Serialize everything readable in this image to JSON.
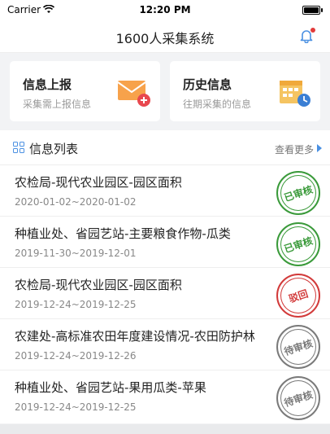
{
  "status_bar": {
    "carrier": "Carrier",
    "time": "12:20 PM"
  },
  "nav": {
    "title": "1600人采集系统",
    "bell_icon": "bell-icon"
  },
  "cards": [
    {
      "title": "信息上报",
      "subtitle": "采集需上报信息",
      "icon": "envelope-add-icon"
    },
    {
      "title": "历史信息",
      "subtitle": "往期采集的信息",
      "icon": "calendar-clock-icon"
    }
  ],
  "list": {
    "title": "信息列表",
    "more": "查看更多",
    "items": [
      {
        "title": "农检局-现代农业园区-园区面积",
        "date": "2020-01-02~2020-01-02",
        "status": "已审核",
        "status_color": "#3a9a3a"
      },
      {
        "title": "种植业处、省园艺站-主要粮食作物-瓜类",
        "date": "2019-11-30~2019-12-01",
        "status": "已审核",
        "status_color": "#3a9a3a"
      },
      {
        "title": "农检局-现代农业园区-园区面积",
        "date": "2019-12-24~2019-12-25",
        "status": "驳回",
        "status_color": "#d23a3a"
      },
      {
        "title": "农建处-高标准农田年度建设情况-农田防护林",
        "date": "2019-12-24~2019-12-26",
        "status": "待审核",
        "status_color": "#7a7a7a"
      },
      {
        "title": "种植业处、省园艺站-果用瓜类-苹果",
        "date": "2019-12-24~2019-12-25",
        "status": "待审核",
        "status_color": "#7a7a7a"
      }
    ]
  }
}
